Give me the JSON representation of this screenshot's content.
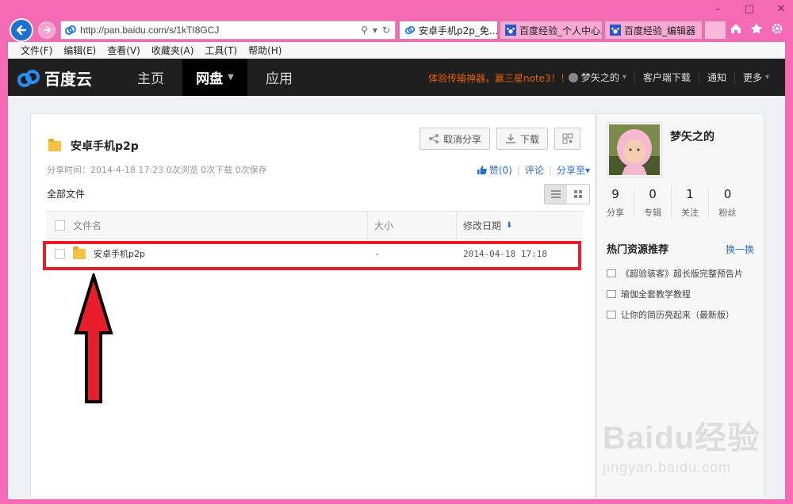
{
  "browser": {
    "address": "http://pan.baidu.com/s/1kTI8GCJ",
    "tabs": [
      {
        "label": "安卓手机p2p_免...",
        "active": true
      },
      {
        "label": "百度经验_个人中心...",
        "active": false
      },
      {
        "label": "百度经验_编辑器",
        "active": false
      }
    ],
    "menu": [
      "文件(F)",
      "编辑(E)",
      "查看(V)",
      "收藏夹(A)",
      "工具(T)",
      "帮助(H)"
    ]
  },
  "header": {
    "logo": "百度云",
    "nav": [
      "主页",
      "网盘",
      "应用"
    ],
    "promo": "体验传输神器，赢三星note3！！",
    "user": "梦矢之的",
    "links": [
      "客户端下载",
      "通知",
      "更多"
    ]
  },
  "share": {
    "title": "安卓手机p2p",
    "buttons": {
      "cancel_share": "取消分享",
      "download": "下载"
    },
    "meta": "分享时间：2014-4-18 17:23 0次浏览 0次下载 0次保存",
    "like": "赞(0)",
    "comment": "评论",
    "share_to": "分享至",
    "all_files": "全部文件"
  },
  "table": {
    "headers": {
      "name": "文件名",
      "size": "大小",
      "date": "修改日期"
    },
    "rows": [
      {
        "name": "安卓手机p2p",
        "size": "-",
        "date": "2014-04-18 17:18"
      }
    ]
  },
  "sidebar": {
    "username": "梦矢之的",
    "stats": [
      {
        "num": "9",
        "label": "分享"
      },
      {
        "num": "0",
        "label": "专辑"
      },
      {
        "num": "1",
        "label": "关注"
      },
      {
        "num": "0",
        "label": "粉丝"
      }
    ],
    "hot_title": "热门资源推荐",
    "refresh": "换一换",
    "hot_items": [
      "《超验骇客》超长版完整预告片",
      "瑜伽全套教学教程",
      "让你的简历亮起来（最新版）"
    ]
  },
  "watermark": {
    "logo": "Baidu经验",
    "url": "jingyan.baidu.com"
  },
  "colors": {
    "frame": "#f46ab5",
    "highlight": "#e81d2a",
    "link": "#2f6ec7",
    "promo": "#e85f00"
  }
}
